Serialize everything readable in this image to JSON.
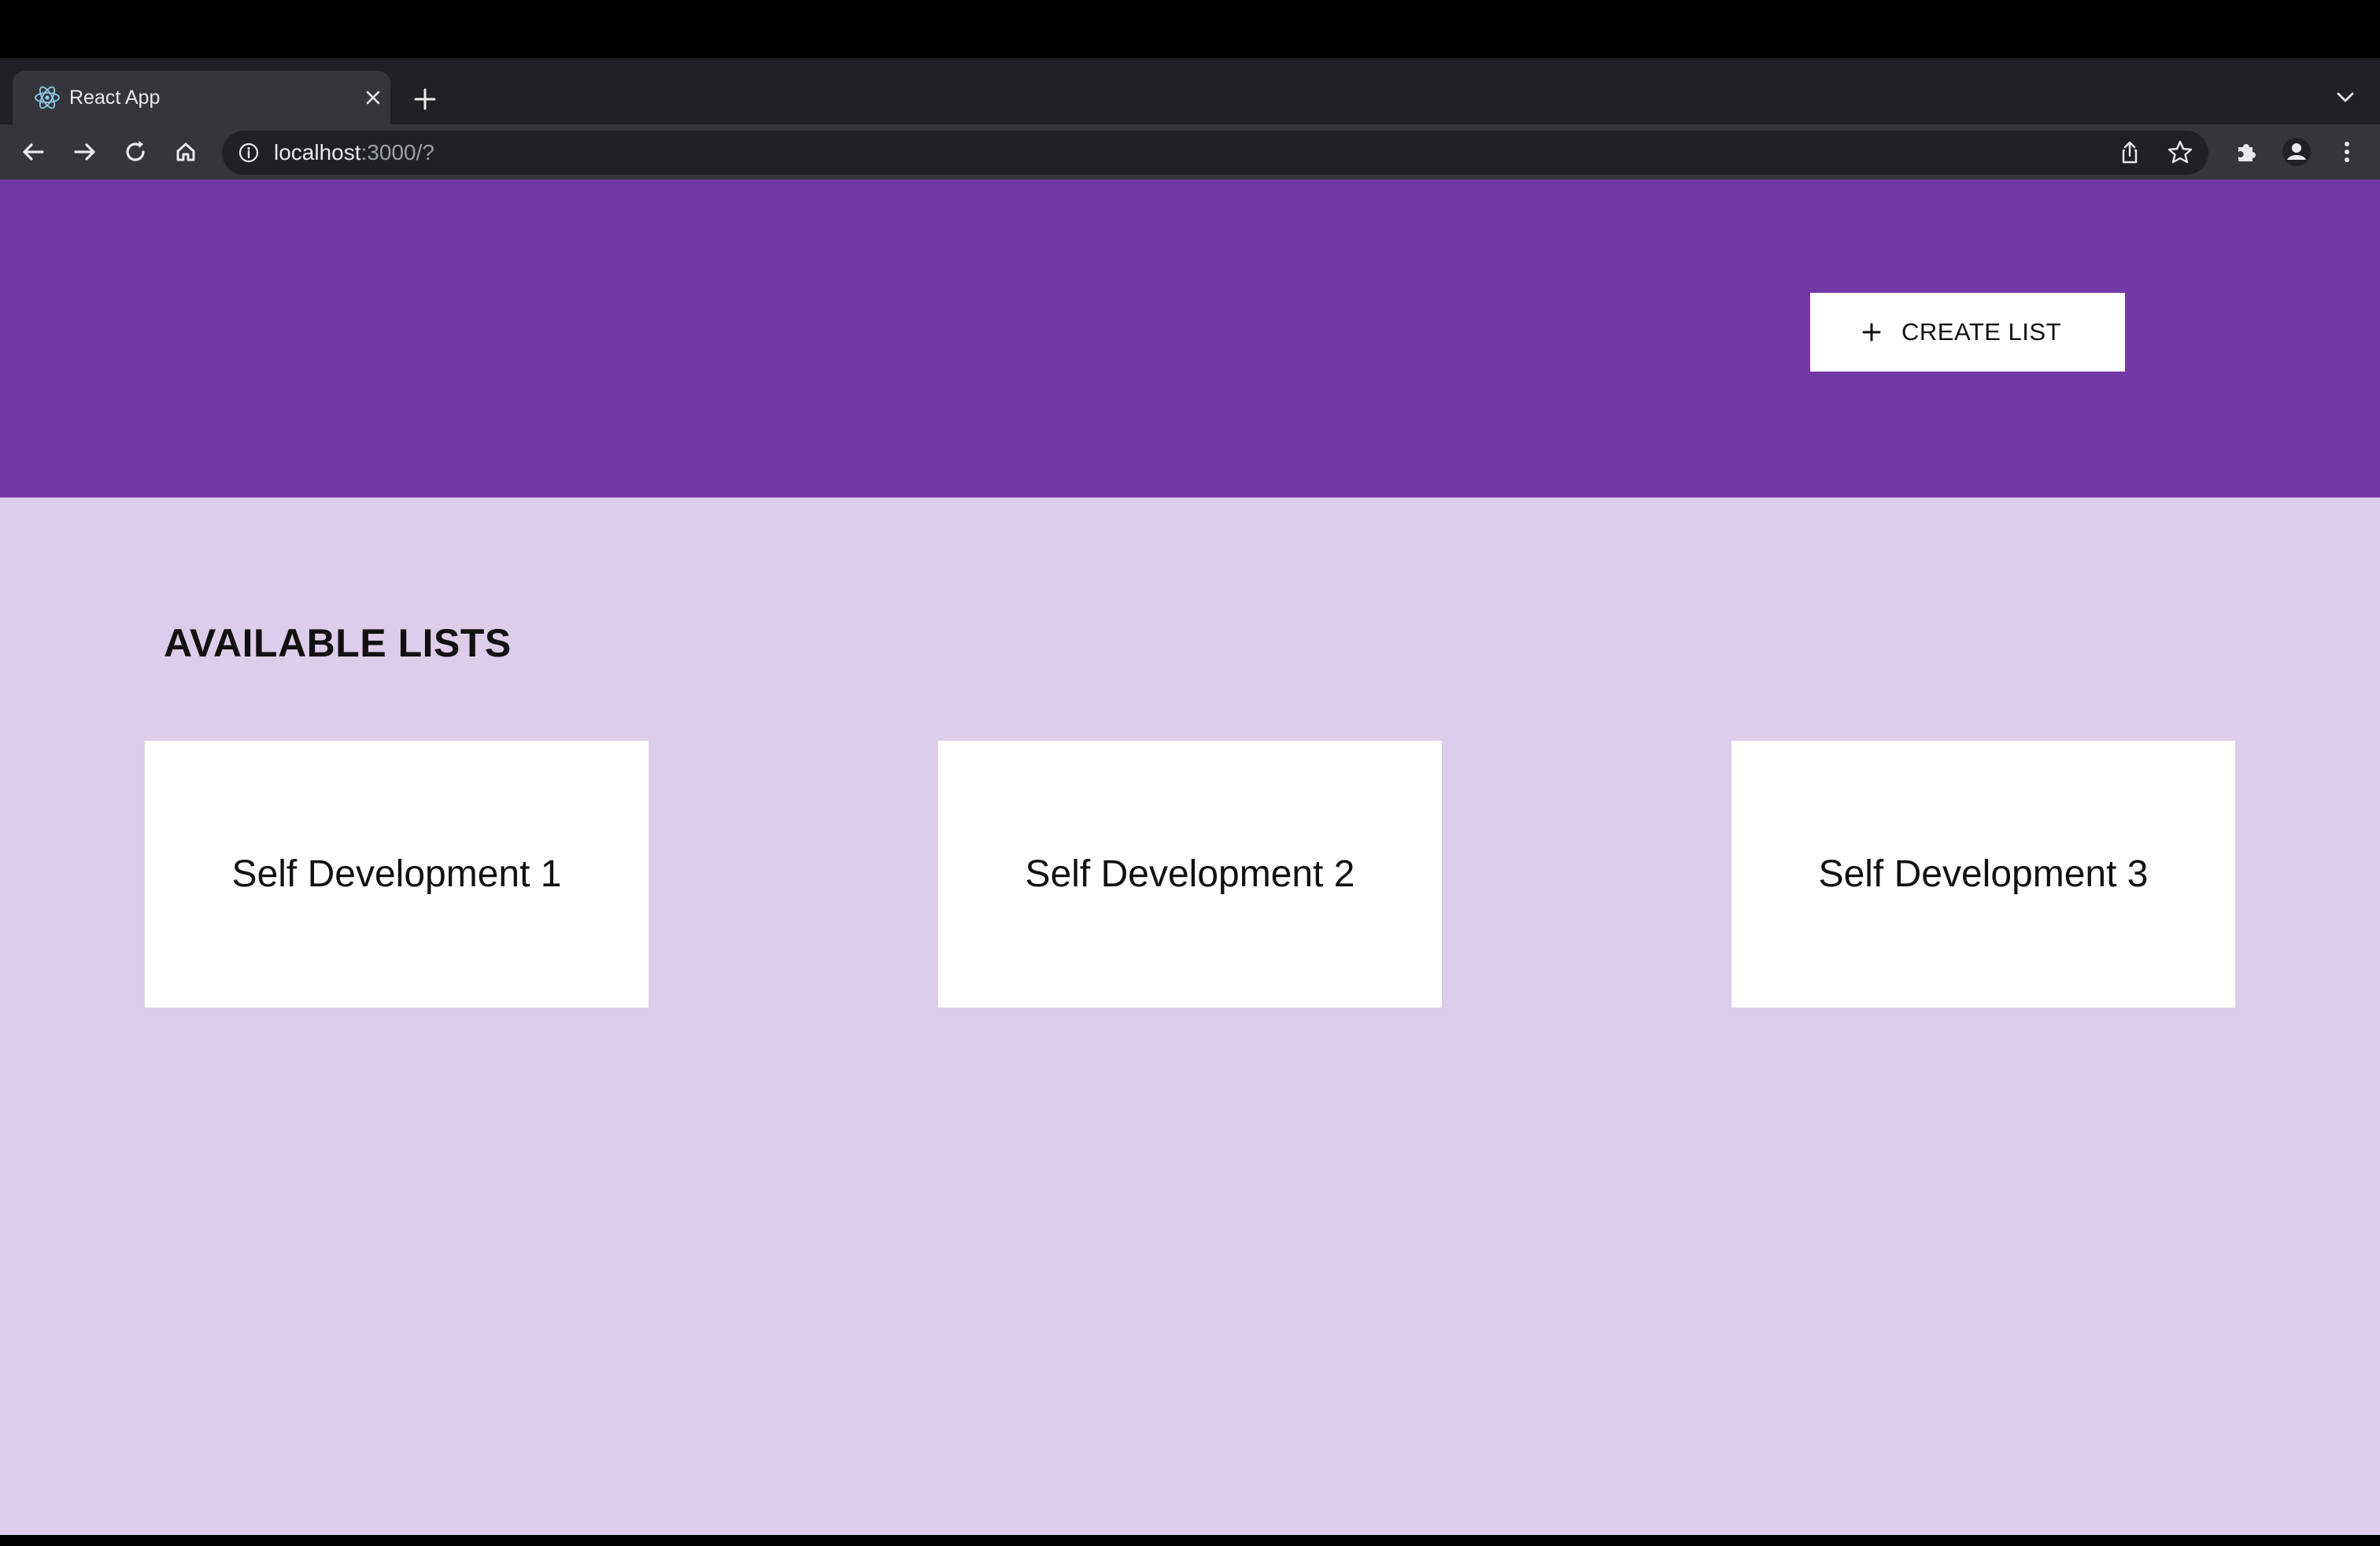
{
  "browser": {
    "tab": {
      "title": "React App",
      "favicon": "react-logo-icon",
      "close_icon": "close-icon"
    },
    "new_tab_icon": "plus-icon",
    "tab_list_icon": "chevron-down-icon",
    "toolbar": {
      "back_icon": "arrow-left-icon",
      "forward_icon": "arrow-right-icon",
      "reload_icon": "reload-icon",
      "home_icon": "home-icon"
    },
    "omnibox": {
      "info_icon": "info-icon",
      "url_host": "localhost",
      "url_rest": ":3000/?",
      "share_icon": "share-icon",
      "bookmark_icon": "star-icon"
    },
    "extensions_icon": "puzzle-icon",
    "profile_icon": "avatar-icon",
    "menu_icon": "kebab-menu-icon"
  },
  "header": {
    "background": "#7438a6",
    "create_button": {
      "icon": "plus-icon",
      "label": "CREATE LIST"
    }
  },
  "main": {
    "background": "#ddcdeb",
    "section_title": "AVAILABLE LISTS",
    "lists": [
      {
        "label": "Self Development 1"
      },
      {
        "label": "Self Development 2"
      },
      {
        "label": "Self Development 3"
      }
    ]
  }
}
